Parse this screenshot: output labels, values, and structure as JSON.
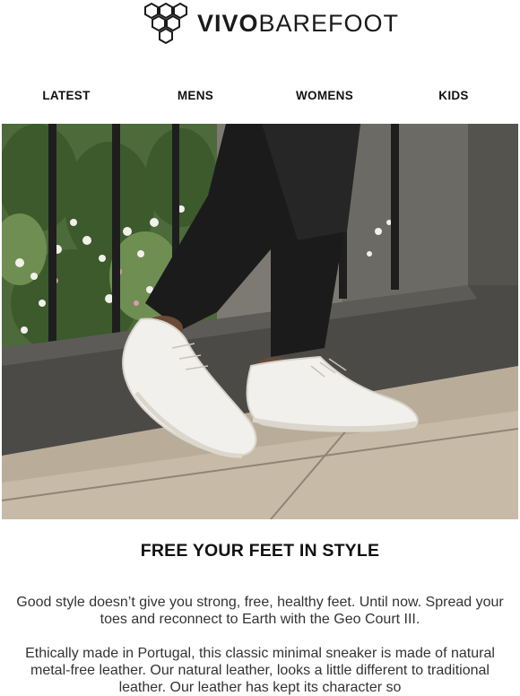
{
  "brand": {
    "name_bold": "VIVO",
    "name_light": "BAREFOOT"
  },
  "nav": {
    "items": [
      {
        "label": "LATEST"
      },
      {
        "label": "MENS"
      },
      {
        "label": "WOMENS"
      },
      {
        "label": "KIDS"
      }
    ]
  },
  "hero": {
    "icon": "hero-photo-white-sneakers"
  },
  "main": {
    "headline": "FREE YOUR FEET IN STYLE",
    "paragraph_1": "Good style doesn’t give you strong, free, healthy feet. Until now. Spread your toes and reconnect to Earth with the Geo Court III.",
    "paragraph_2": "Ethically made in Portugal, this classic minimal sneaker is made of natural metal-free leather. Our natural leather, looks a little different to traditional leather. Our leather has kept its character so"
  }
}
